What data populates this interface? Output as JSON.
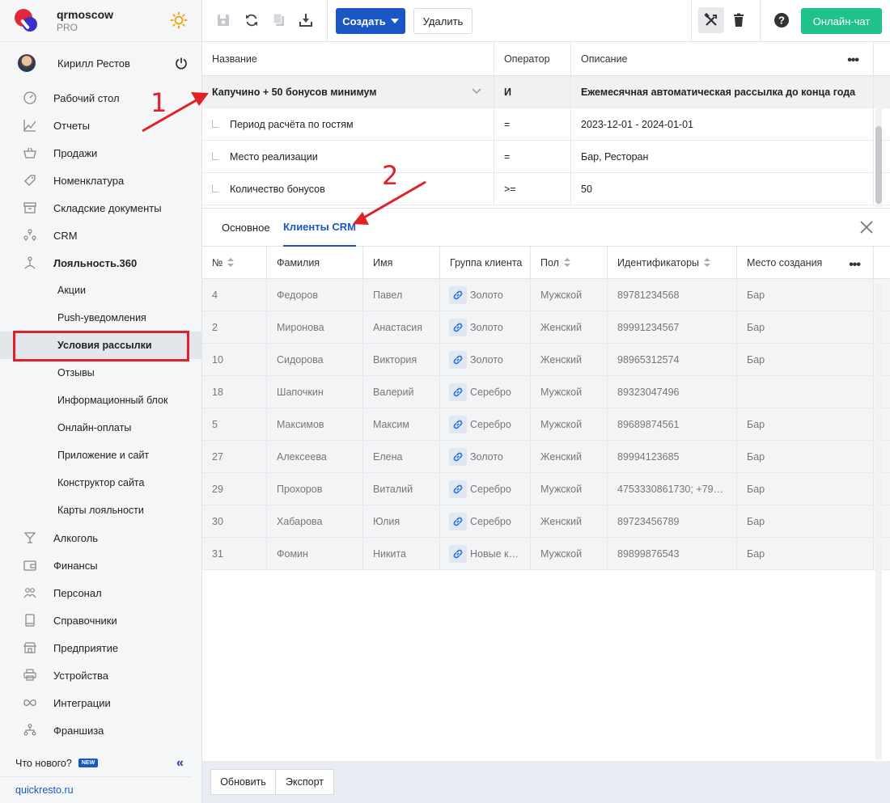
{
  "brand": {
    "name": "qrmoscow",
    "plan": "PRO"
  },
  "user": {
    "name": "Кирилл Рестов"
  },
  "nav": [
    {
      "label": "Рабочий стол",
      "icon": "gauge-icon",
      "level": "top"
    },
    {
      "label": "Отчеты",
      "icon": "chart-icon",
      "level": "top"
    },
    {
      "label": "Продажи",
      "icon": "basket-icon",
      "level": "top"
    },
    {
      "label": "Номенклатура",
      "icon": "tag-icon",
      "level": "top"
    },
    {
      "label": "Складские документы",
      "icon": "archive-icon",
      "level": "top"
    },
    {
      "label": "CRM",
      "icon": "people-icon",
      "level": "top"
    },
    {
      "label": "Лояльность.360",
      "icon": "loyalty-icon",
      "level": "top",
      "bold": true
    },
    {
      "label": "Акции",
      "level": "sub"
    },
    {
      "label": "Push-уведомления",
      "level": "sub"
    },
    {
      "label": "Условия рассылки",
      "level": "sub",
      "active": true
    },
    {
      "label": "Отзывы",
      "level": "sub"
    },
    {
      "label": "Информационный блок",
      "level": "sub"
    },
    {
      "label": "Онлайн-оплаты",
      "level": "sub"
    },
    {
      "label": "Приложение и сайт",
      "level": "sub"
    },
    {
      "label": "Конструктор сайта",
      "level": "sub"
    },
    {
      "label": "Карты лояльности",
      "level": "sub"
    },
    {
      "label": "Алкоголь",
      "icon": "glass-icon",
      "level": "top"
    },
    {
      "label": "Финансы",
      "icon": "wallet-icon",
      "level": "top"
    },
    {
      "label": "Персонал",
      "icon": "staff-icon",
      "level": "top"
    },
    {
      "label": "Справочники",
      "icon": "book-icon",
      "level": "top"
    },
    {
      "label": "Предприятие",
      "icon": "store-icon",
      "level": "top"
    },
    {
      "label": "Устройства",
      "icon": "printer-icon",
      "level": "top"
    },
    {
      "label": "Интеграции",
      "icon": "infinity-icon",
      "level": "top"
    },
    {
      "label": "Франшиза",
      "icon": "network-icon",
      "level": "top"
    }
  ],
  "footer": {
    "whats_new": "Что нового?",
    "new_badge": "NEW",
    "site": "quickresto.ru"
  },
  "toolbar": {
    "create_label": "Создать",
    "delete_label": "Удалить",
    "chat_label": "Онлайн-чат"
  },
  "conditions": {
    "columns": [
      "Название",
      "Оператор",
      "Описание"
    ],
    "rows": [
      {
        "name": "Капучино + 50 бонусов минимум",
        "operator": "И",
        "description": "Ежемесячная автоматическая рассылка до конца года",
        "group": true
      },
      {
        "name": "Период расчёта по гостям",
        "operator": "=",
        "description": "2023-12-01 - 2024-01-01"
      },
      {
        "name": "Место реализации",
        "operator": "=",
        "description": "Бар, Ресторан"
      },
      {
        "name": "Количество бонусов",
        "operator": ">=",
        "description": "50"
      }
    ]
  },
  "tabs": [
    {
      "label": "Основное",
      "active": false
    },
    {
      "label": "Клиенты CRM",
      "active": true
    }
  ],
  "clients": {
    "columns": [
      "№",
      "Фамилия",
      "Имя",
      "Группа клиента",
      "Пол",
      "Идентификаторы",
      "Место создания"
    ],
    "rows": [
      [
        "4",
        "Федоров",
        "Павел",
        "Золото",
        "Мужской",
        "89781234568",
        "Бар"
      ],
      [
        "2",
        "Миронова",
        "Анастасия",
        "Золото",
        "Женский",
        "89991234567",
        "Бар"
      ],
      [
        "10",
        "Сидорова",
        "Виктория",
        "Золото",
        "Женский",
        "98965312574",
        "Бар"
      ],
      [
        "18",
        "Шапочкин",
        "Валерий",
        "Серебро",
        "Мужской",
        "89323047496",
        ""
      ],
      [
        "5",
        "Максимов",
        "Максим",
        "Серебро",
        "Мужской",
        "89689874561",
        "Бар"
      ],
      [
        "27",
        "Алексеева",
        "Елена",
        "Золото",
        "Женский",
        "89994123685",
        "Бар"
      ],
      [
        "29",
        "Прохоров",
        "Виталий",
        "Серебро",
        "Мужской",
        "4753330861730; +79…",
        "Бар"
      ],
      [
        "30",
        "Хабарова",
        "Юлия",
        "Серебро",
        "Женский",
        "89723456789",
        "Бар"
      ],
      [
        "31",
        "Фомин",
        "Никита",
        "Новые к…",
        "Мужской",
        "89899876543",
        "Бар"
      ]
    ]
  },
  "bottom": {
    "refresh_label": "Обновить",
    "export_label": "Экспорт"
  },
  "annotations": {
    "one": "1",
    "two": "2"
  },
  "colors": {
    "accent": "#1a56c6",
    "chat": "#1fc28b",
    "annotation": "#e02127"
  }
}
